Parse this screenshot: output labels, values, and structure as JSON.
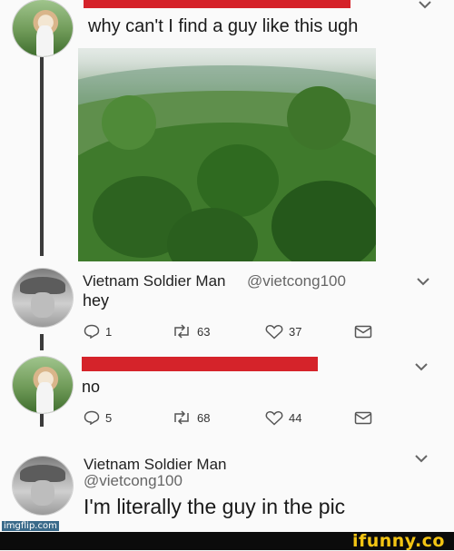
{
  "tweets": [
    {
      "text": "why can't I find a guy like this ugh"
    },
    {
      "author_name": "Vietnam Soldier Man",
      "handle": "@vietcong100",
      "text": "hey",
      "replies": "1",
      "retweets": "63",
      "likes": "37"
    },
    {
      "text": "no",
      "replies": "5",
      "retweets": "68",
      "likes": "44"
    },
    {
      "author_name": "Vietnam Soldier Man",
      "handle": "@vietcong100",
      "text": "I'm literally the guy in the pic"
    }
  ],
  "watermark_left": "imgflip.com",
  "watermark_right": "ifunny.co",
  "colors": {
    "redaction": "#d5232a",
    "thread_line": "#3b3b3b",
    "ifunny_yellow": "#f3c413"
  }
}
